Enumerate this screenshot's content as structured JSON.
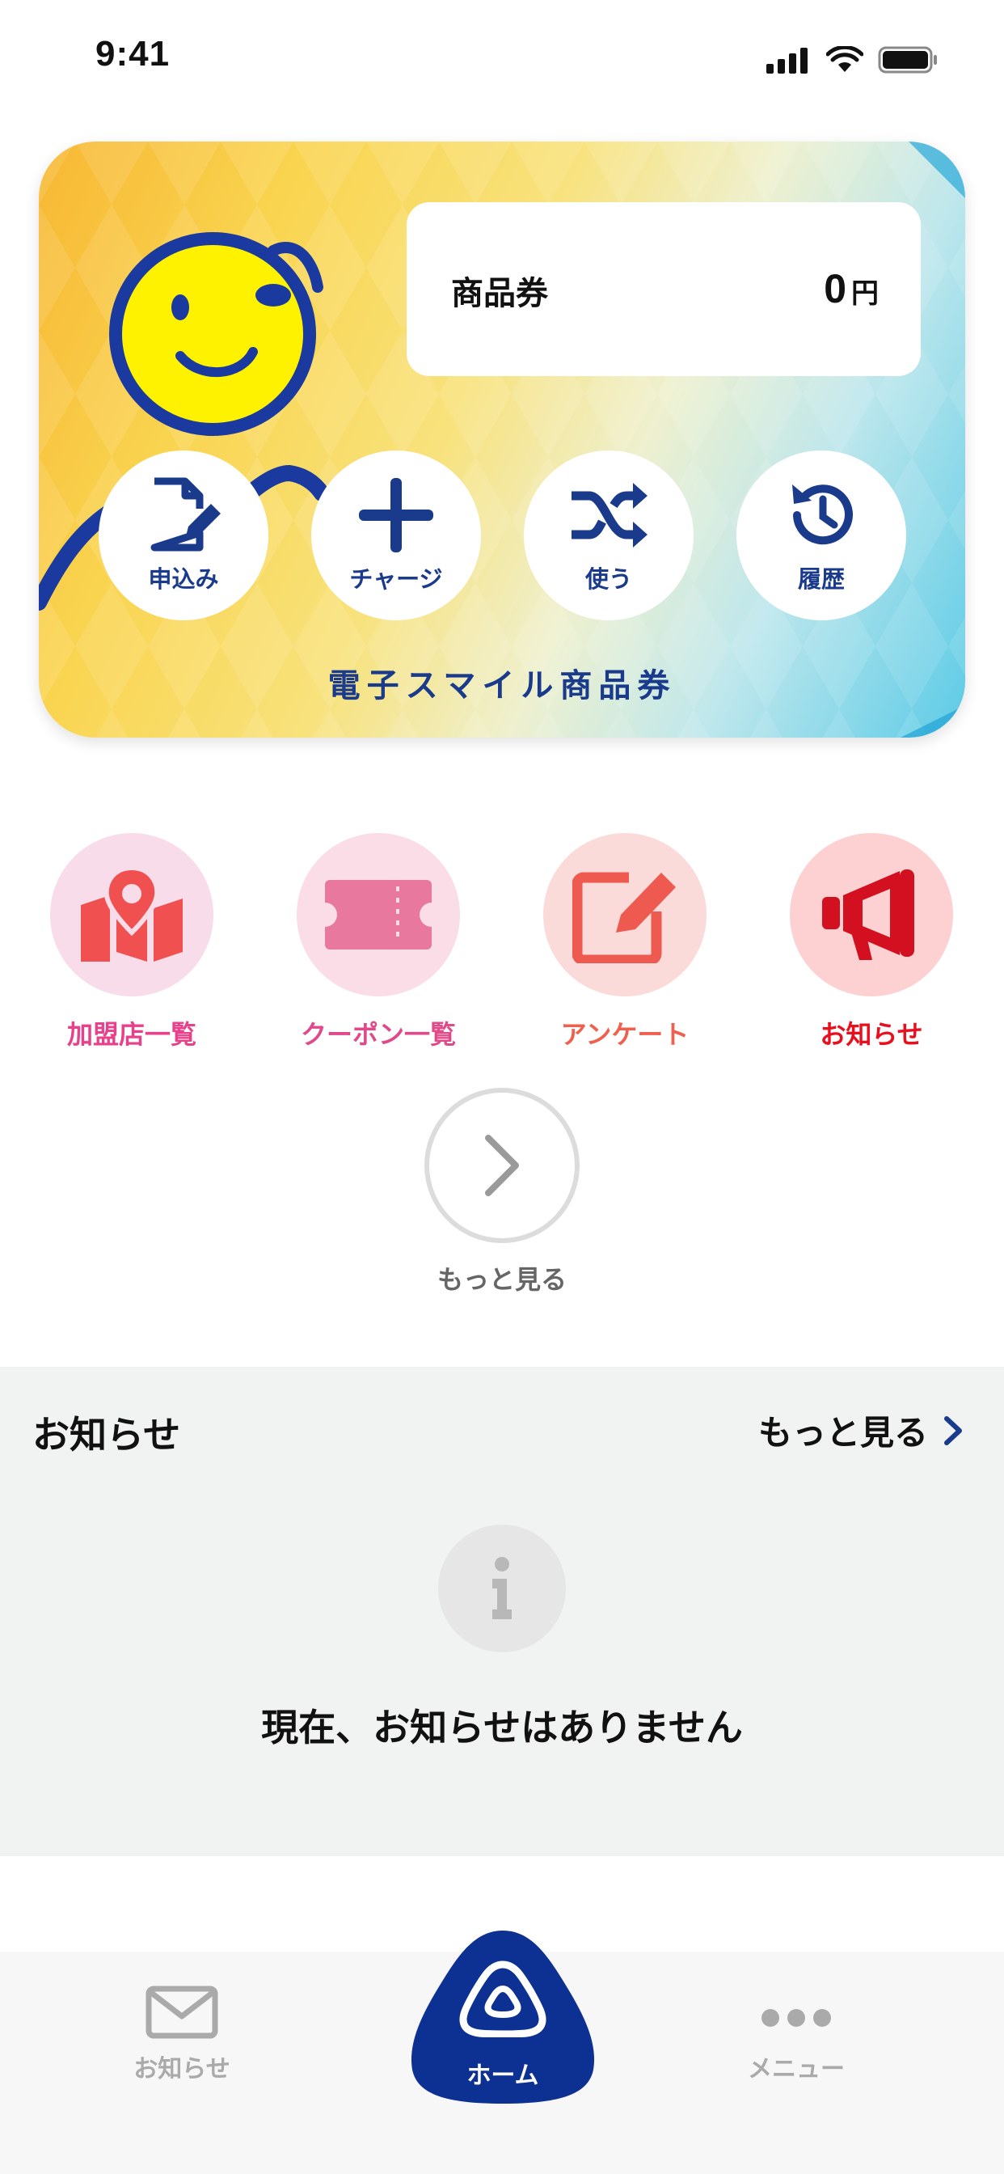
{
  "status_bar": {
    "time": "9:41"
  },
  "card": {
    "balance_label": "商品券",
    "balance_amount": "0",
    "balance_unit": "円",
    "actions": [
      {
        "label": "申込み",
        "icon": "apply-document-icon"
      },
      {
        "label": "チャージ",
        "icon": "plus-icon"
      },
      {
        "label": "使う",
        "icon": "shuffle-icon"
      },
      {
        "label": "履歴",
        "icon": "history-icon"
      }
    ],
    "title": "電子スマイル商品券"
  },
  "shortcuts": [
    {
      "label": "加盟店一覧",
      "icon": "map-pin-icon",
      "color": "#e8408a",
      "bg": "#f9dcea"
    },
    {
      "label": "クーポン一覧",
      "icon": "ticket-icon",
      "color": "#e04a8a",
      "bg": "#fbdde7"
    },
    {
      "label": "アンケート",
      "icon": "edit-icon",
      "color": "#f0604f",
      "bg": "#fbdada"
    },
    {
      "label": "お知らせ",
      "icon": "megaphone-icon",
      "color": "#e8101f",
      "bg": "#fdd1d1"
    }
  ],
  "more": {
    "label": "もっと見る"
  },
  "notices": {
    "title": "お知らせ",
    "more_label": "もっと見る",
    "empty_message": "現在、お知らせはありません"
  },
  "bottom_nav": {
    "items": [
      {
        "label": "お知らせ",
        "icon": "mail-icon"
      },
      {
        "label": "ホーム",
        "icon": "home-logo-icon"
      },
      {
        "label": "メニュー",
        "icon": "more-dots-icon"
      }
    ]
  },
  "colors": {
    "brand_navy": "#1a3a8c",
    "home_blue": "#0d3192"
  }
}
